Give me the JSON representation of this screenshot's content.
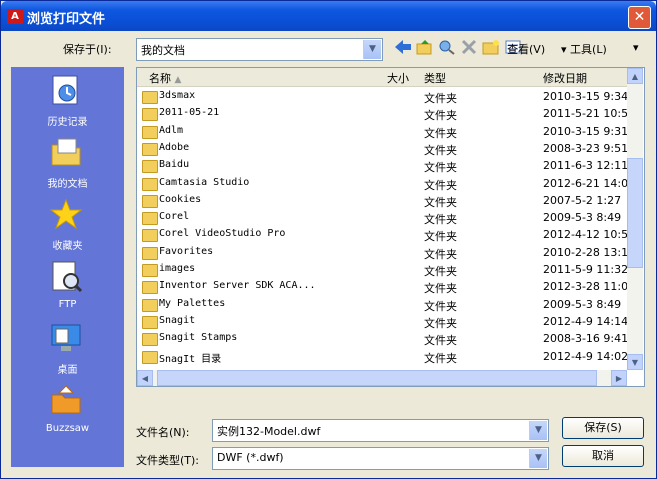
{
  "window": {
    "title": "浏览打印文件",
    "app_icon": "acrobat-icon",
    "close_symbol": "✕"
  },
  "toolbar": {
    "save_in_label": "保存于(I):",
    "save_in_value": "我的文档",
    "view_label": "查看(V)",
    "tools_label": "工具(L)"
  },
  "places": [
    {
      "label": "历史记录",
      "icon": "history-icon"
    },
    {
      "label": "我的文档",
      "icon": "my-documents-icon"
    },
    {
      "label": "收藏夹",
      "icon": "favorites-icon"
    },
    {
      "label": "FTP",
      "icon": "ftp-icon"
    },
    {
      "label": "桌面",
      "icon": "desktop-icon"
    },
    {
      "label": "Buzzsaw",
      "icon": "buzzsaw-icon"
    }
  ],
  "columns": {
    "name": "名称",
    "size": "大小",
    "type": "类型",
    "modified": "修改日期"
  },
  "files": [
    {
      "name": "3dsmax",
      "type": "文件夹",
      "date": "2010-3-15 9:34"
    },
    {
      "name": "2011-05-21",
      "type": "文件夹",
      "date": "2011-5-21 10:5"
    },
    {
      "name": "Adlm",
      "type": "文件夹",
      "date": "2010-3-15 9:31"
    },
    {
      "name": "Adobe",
      "type": "文件夹",
      "date": "2008-3-23 9:51"
    },
    {
      "name": "Baidu",
      "type": "文件夹",
      "date": "2011-6-3 12:11"
    },
    {
      "name": "Camtasia Studio",
      "type": "文件夹",
      "date": "2012-6-21 14:0"
    },
    {
      "name": "Cookies",
      "type": "文件夹",
      "date": "2007-5-2 1:27"
    },
    {
      "name": "Corel",
      "type": "文件夹",
      "date": "2009-5-3 8:49"
    },
    {
      "name": "Corel VideoStudio Pro",
      "type": "文件夹",
      "date": "2012-4-12 10:5"
    },
    {
      "name": "Favorites",
      "type": "文件夹",
      "date": "2010-2-28 13:1"
    },
    {
      "name": "images",
      "type": "文件夹",
      "date": "2011-5-9 11:32"
    },
    {
      "name": "Inventor Server SDK ACA...",
      "type": "文件夹",
      "date": "2012-3-28 11:0"
    },
    {
      "name": "My Palettes",
      "type": "文件夹",
      "date": "2009-5-3 8:49"
    },
    {
      "name": "Snagit",
      "type": "文件夹",
      "date": "2012-4-9 14:14"
    },
    {
      "name": "Snagit Stamps",
      "type": "文件夹",
      "date": "2008-3-16 9:41"
    },
    {
      "name": "SnagIt 目录",
      "type": "文件夹",
      "date": "2012-4-9 14:02"
    }
  ],
  "filename": {
    "label": "文件名(N):",
    "value": "实例132-Model.dwf"
  },
  "filetype": {
    "label": "文件类型(T):",
    "value": "DWF (*.dwf)"
  },
  "buttons": {
    "save": "保存(S)",
    "cancel": "取消"
  }
}
